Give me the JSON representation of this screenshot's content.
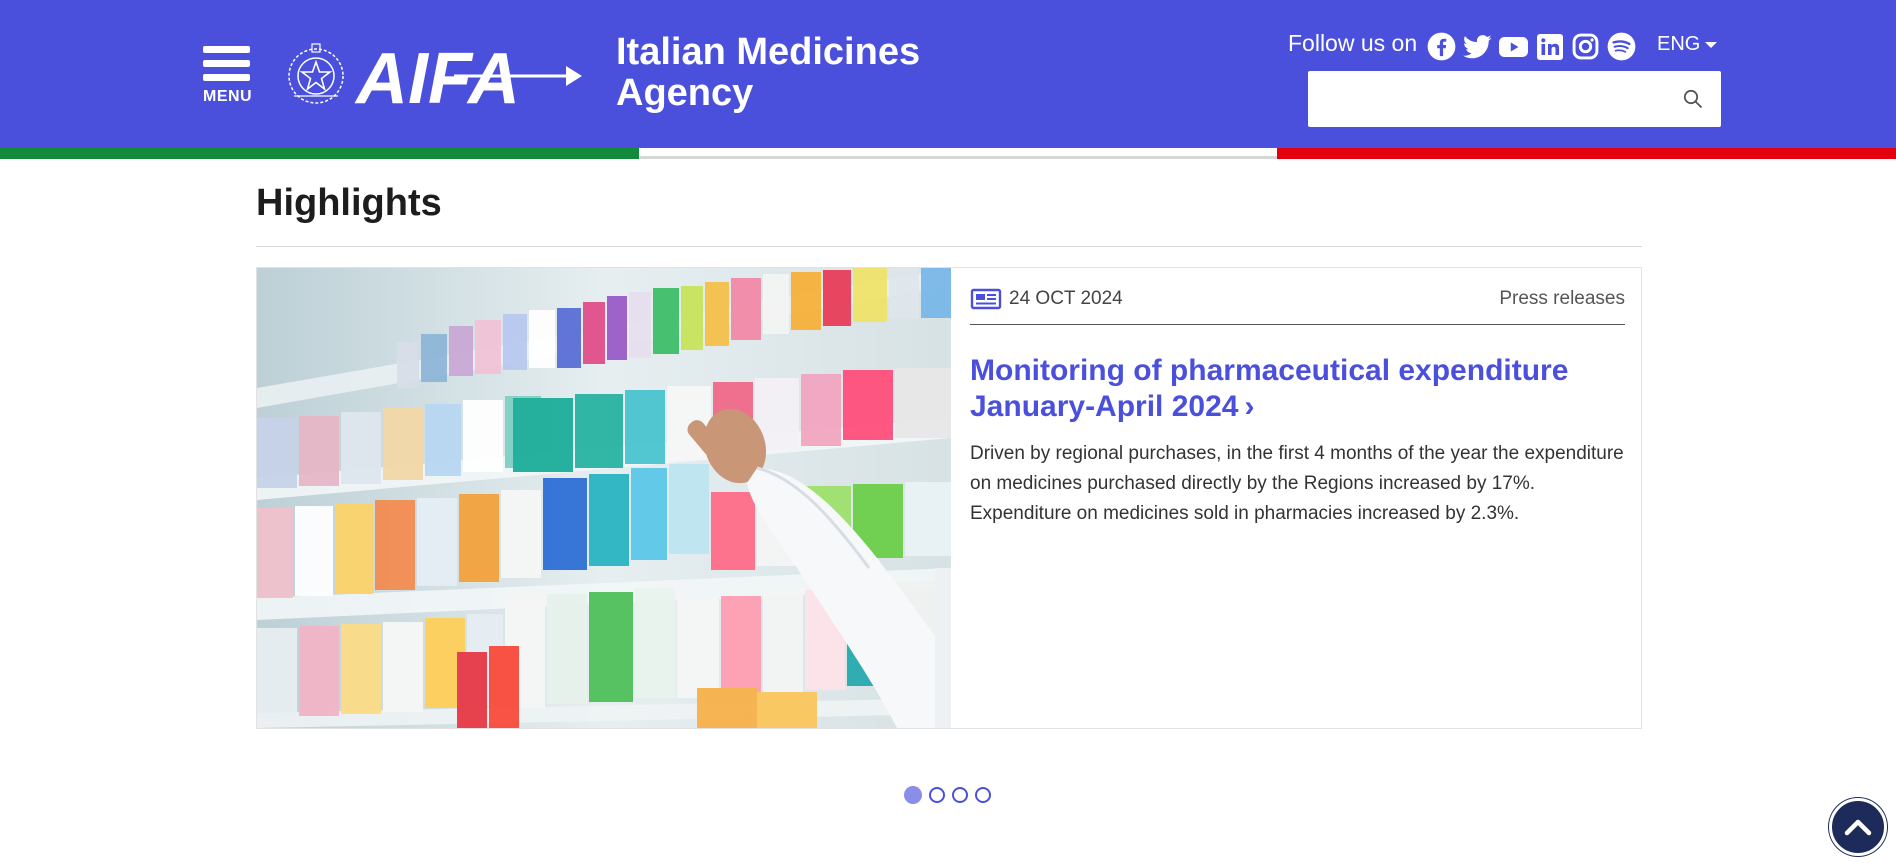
{
  "header": {
    "menu_label": "MENU",
    "logo_text": "AIFA",
    "agency_name": "Italian Medicines Agency",
    "follow_label": "Follow us on",
    "socials": [
      "facebook-icon",
      "twitter-icon",
      "youtube-icon",
      "linkedin-icon",
      "instagram-icon",
      "spotify-icon"
    ],
    "language": "ENG",
    "search": {
      "value": "",
      "placeholder": ""
    }
  },
  "colors": {
    "brand": "#4a50dc",
    "flag_green": "#128a3a",
    "flag_white": "#ffffff",
    "flag_red": "#e3000f",
    "back_to_top": "#1c2b59"
  },
  "highlights": {
    "title": "Highlights",
    "card": {
      "image_alt": "pharmacist picking medicine box from pharmacy shelves",
      "date": "24 OCT 2024",
      "category": "Press releases",
      "title": "Monitoring of pharmaceutical expenditure January-April 2024",
      "text": "Driven by regional purchases, in the first 4 months of the year the expenditure on medicines purchased directly by the Regions increased by 17%. Expenditure on medicines sold in pharmacies increased by 2.3%."
    },
    "carousel": {
      "slides": 4,
      "active": 1
    }
  }
}
